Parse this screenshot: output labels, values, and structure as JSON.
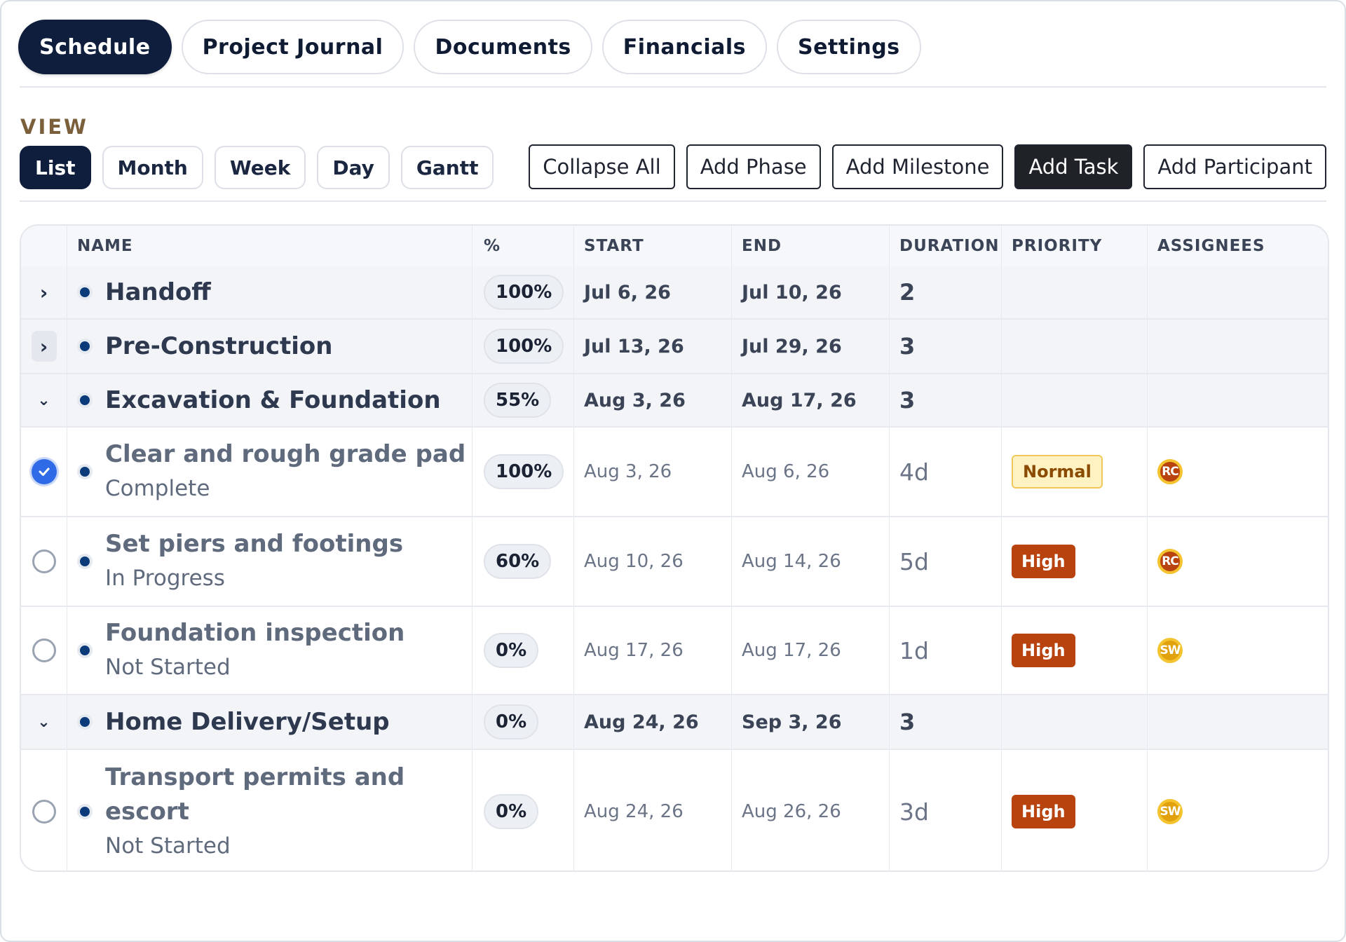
{
  "tabs": [
    "Schedule",
    "Project Journal",
    "Documents",
    "Financials",
    "Settings"
  ],
  "view": {
    "label": "VIEW",
    "options": [
      "List",
      "Month",
      "Week",
      "Day",
      "Gantt"
    ],
    "active": "List"
  },
  "actions": [
    "Collapse All",
    "Add Phase",
    "Add Milestone",
    "Add Task",
    "Add Participant"
  ],
  "table": {
    "headers": [
      "NAME",
      "%",
      "START",
      "END",
      "DURATION",
      "PRIORITY",
      "ASSIGNEES"
    ],
    "rows": [
      {
        "type": "phase",
        "name": "Handoff",
        "pct": "100%",
        "start": "Jul 6, 26",
        "end": "Jul 10, 26",
        "duration": "2"
      },
      {
        "type": "phase",
        "name": "Pre-Construction",
        "pct": "100%",
        "start": "Jul 13, 26",
        "end": "Jul 29, 26",
        "duration": "3"
      },
      {
        "type": "phase",
        "name": "Excavation & Foundation",
        "pct": "55%",
        "start": "Aug 3, 26",
        "end": "Aug 17, 26",
        "duration": "3"
      },
      {
        "type": "task",
        "name": "Clear and rough grade pad",
        "status": "Complete",
        "pct": "100%",
        "start": "Aug 3, 26",
        "end": "Aug 6, 26",
        "duration": "4d",
        "priority": "Normal",
        "assignee": "RC"
      },
      {
        "type": "task",
        "name": "Set piers and footings",
        "status": "In Progress",
        "pct": "60%",
        "start": "Aug 10, 26",
        "end": "Aug 14, 26",
        "duration": "5d",
        "priority": "High",
        "assignee": "RC"
      },
      {
        "type": "task",
        "name": "Foundation inspection",
        "status": "Not Started",
        "pct": "0%",
        "start": "Aug 17, 26",
        "end": "Aug 17, 26",
        "duration": "1d",
        "priority": "High",
        "assignee": "SW"
      },
      {
        "type": "phase",
        "name": "Home Delivery/Setup",
        "pct": "0%",
        "start": "Aug 24, 26",
        "end": "Sep 3, 26",
        "duration": "3"
      },
      {
        "type": "task",
        "name_line1": "Transport permits and",
        "name_line2": "escort",
        "status": "Not Started",
        "pct": "0%",
        "start": "Aug 24, 26",
        "end": "Aug 26, 26",
        "duration": "3d",
        "priority": "High",
        "assignee": "SW"
      }
    ]
  },
  "colors": {
    "accent_dark": "#0f1e3c",
    "high": "#b8430e",
    "normal_bg": "#fff2c2",
    "check": "#2f6be6",
    "dot": "#0a3a7a"
  },
  "icons": {
    "expanded": "chevron-down-icon",
    "collapsed": "chevron-right-icon",
    "done": "check-circle-icon",
    "todo": "empty-circle-icon"
  }
}
